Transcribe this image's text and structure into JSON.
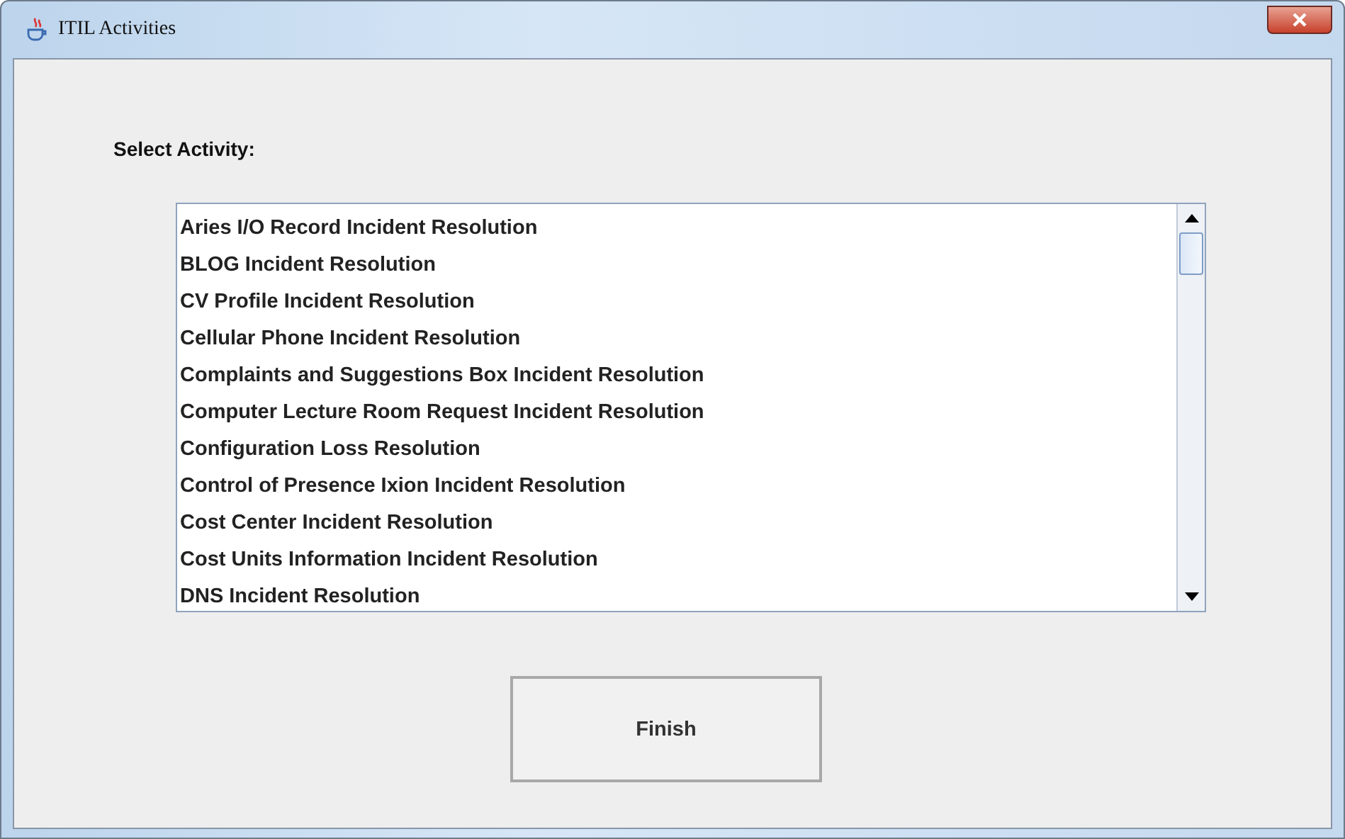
{
  "window": {
    "title": "ITIL Activities"
  },
  "label": "Select Activity:",
  "activities": [
    "Aries I/O Record Incident Resolution",
    "BLOG Incident Resolution",
    "CV Profile Incident Resolution",
    "Cellular Phone Incident Resolution",
    "Complaints and Suggestions Box Incident Resolution",
    "Computer Lecture Room Request Incident Resolution",
    "Configuration Loss Resolution",
    "Control of Presence Ixion Incident Resolution",
    "Cost Center Incident Resolution",
    "Cost Units Information Incident Resolution",
    "DNS Incident Resolution"
  ],
  "button": "Finish"
}
